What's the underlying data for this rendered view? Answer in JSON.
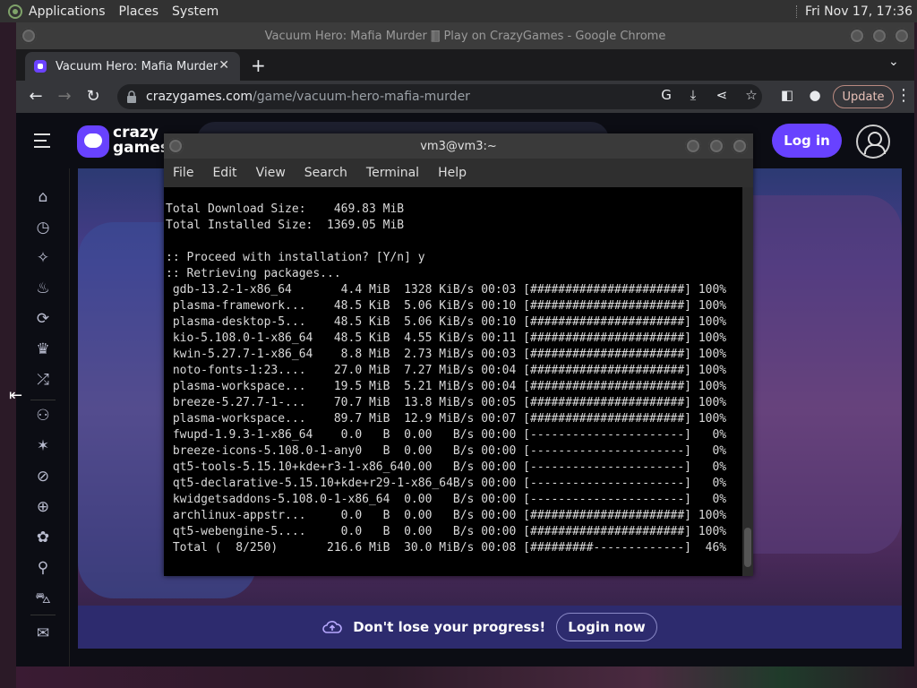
{
  "topbar": {
    "applications": "Applications",
    "places": "Places",
    "system": "System",
    "clock": "Fri Nov 17, 17:36"
  },
  "chrome": {
    "window_title": "Vacuum Hero: Mafia Murder 🀫 Play on CrazyGames - Google Chrome",
    "tab_title": "Vacuum Hero: Mafia Murder",
    "url_host": "crazygames.com",
    "url_path": "/game/vacuum-hero-mafia-murder",
    "update_label": "Update"
  },
  "page": {
    "brand_top": "crazy",
    "brand_bottom": "games",
    "login_label": "Log in",
    "progress_text": "Don't lose your progress!",
    "login_now_label": "Login now"
  },
  "terminal": {
    "title": "vm3@vm3:~",
    "menu": [
      "File",
      "Edit",
      "View",
      "Search",
      "Terminal",
      "Help"
    ],
    "lines": [
      "",
      "Total Download Size:    469.83 MiB",
      "Total Installed Size:  1369.05 MiB",
      "",
      ":: Proceed with installation? [Y/n] y",
      ":: Retrieving packages...",
      " gdb-13.2-1-x86_64       4.4 MiB  1328 KiB/s 00:03 [######################] 100%",
      " plasma-framework...    48.5 KiB  5.06 KiB/s 00:10 [######################] 100%",
      " plasma-desktop-5...    48.5 KiB  5.06 KiB/s 00:10 [######################] 100%",
      " kio-5.108.0-1-x86_64   48.5 KiB  4.55 KiB/s 00:11 [######################] 100%",
      " kwin-5.27.7-1-x86_64    8.8 MiB  2.73 MiB/s 00:03 [######################] 100%",
      " noto-fonts-1:23....    27.0 MiB  7.27 MiB/s 00:04 [######################] 100%",
      " plasma-workspace...    19.5 MiB  5.21 MiB/s 00:04 [######################] 100%",
      " breeze-5.27.7-1-...    70.7 MiB  13.8 MiB/s 00:05 [######################] 100%",
      " plasma-workspace...    89.7 MiB  12.9 MiB/s 00:07 [######################] 100%",
      " fwupd-1.9.3-1-x86_64    0.0   B  0.00   B/s 00:00 [----------------------]   0%",
      " breeze-icons-5.108.0-1-any0   B  0.00   B/s 00:00 [----------------------]   0%",
      " qt5-tools-5.15.10+kde+r3-1-x86_640.00   B/s 00:00 [----------------------]   0%",
      " qt5-declarative-5.15.10+kde+r29-1-x86_64B/s 00:00 [----------------------]   0%",
      " kwidgetsaddons-5.108.0-1-x86_64  0.00   B/s 00:00 [----------------------]   0%",
      " archlinux-appstr...     0.0   B  0.00   B/s 00:00 [######################] 100%",
      " qt5-webengine-5....     0.0   B  0.00   B/s 00:00 [######################] 100%",
      " Total (  8/250)       216.6 MiB  30.0 MiB/s 00:08 [#########-------------]  46%"
    ]
  },
  "icons": {
    "sidebar": [
      "home-icon",
      "clock-icon",
      "sparkle-icon",
      "flame-icon",
      "refresh-icon",
      "trophy-icon",
      "shuffle-icon",
      "two-player-icon",
      "action-icon",
      "compass-icon",
      "basketball-icon",
      "flower-icon",
      "bicycle-icon",
      "car-icon",
      "mail-icon"
    ]
  },
  "colors": {
    "brand_purple": "#6842ff",
    "progress_bg": "#2d2b6e",
    "update_outline": "#b98a80"
  }
}
